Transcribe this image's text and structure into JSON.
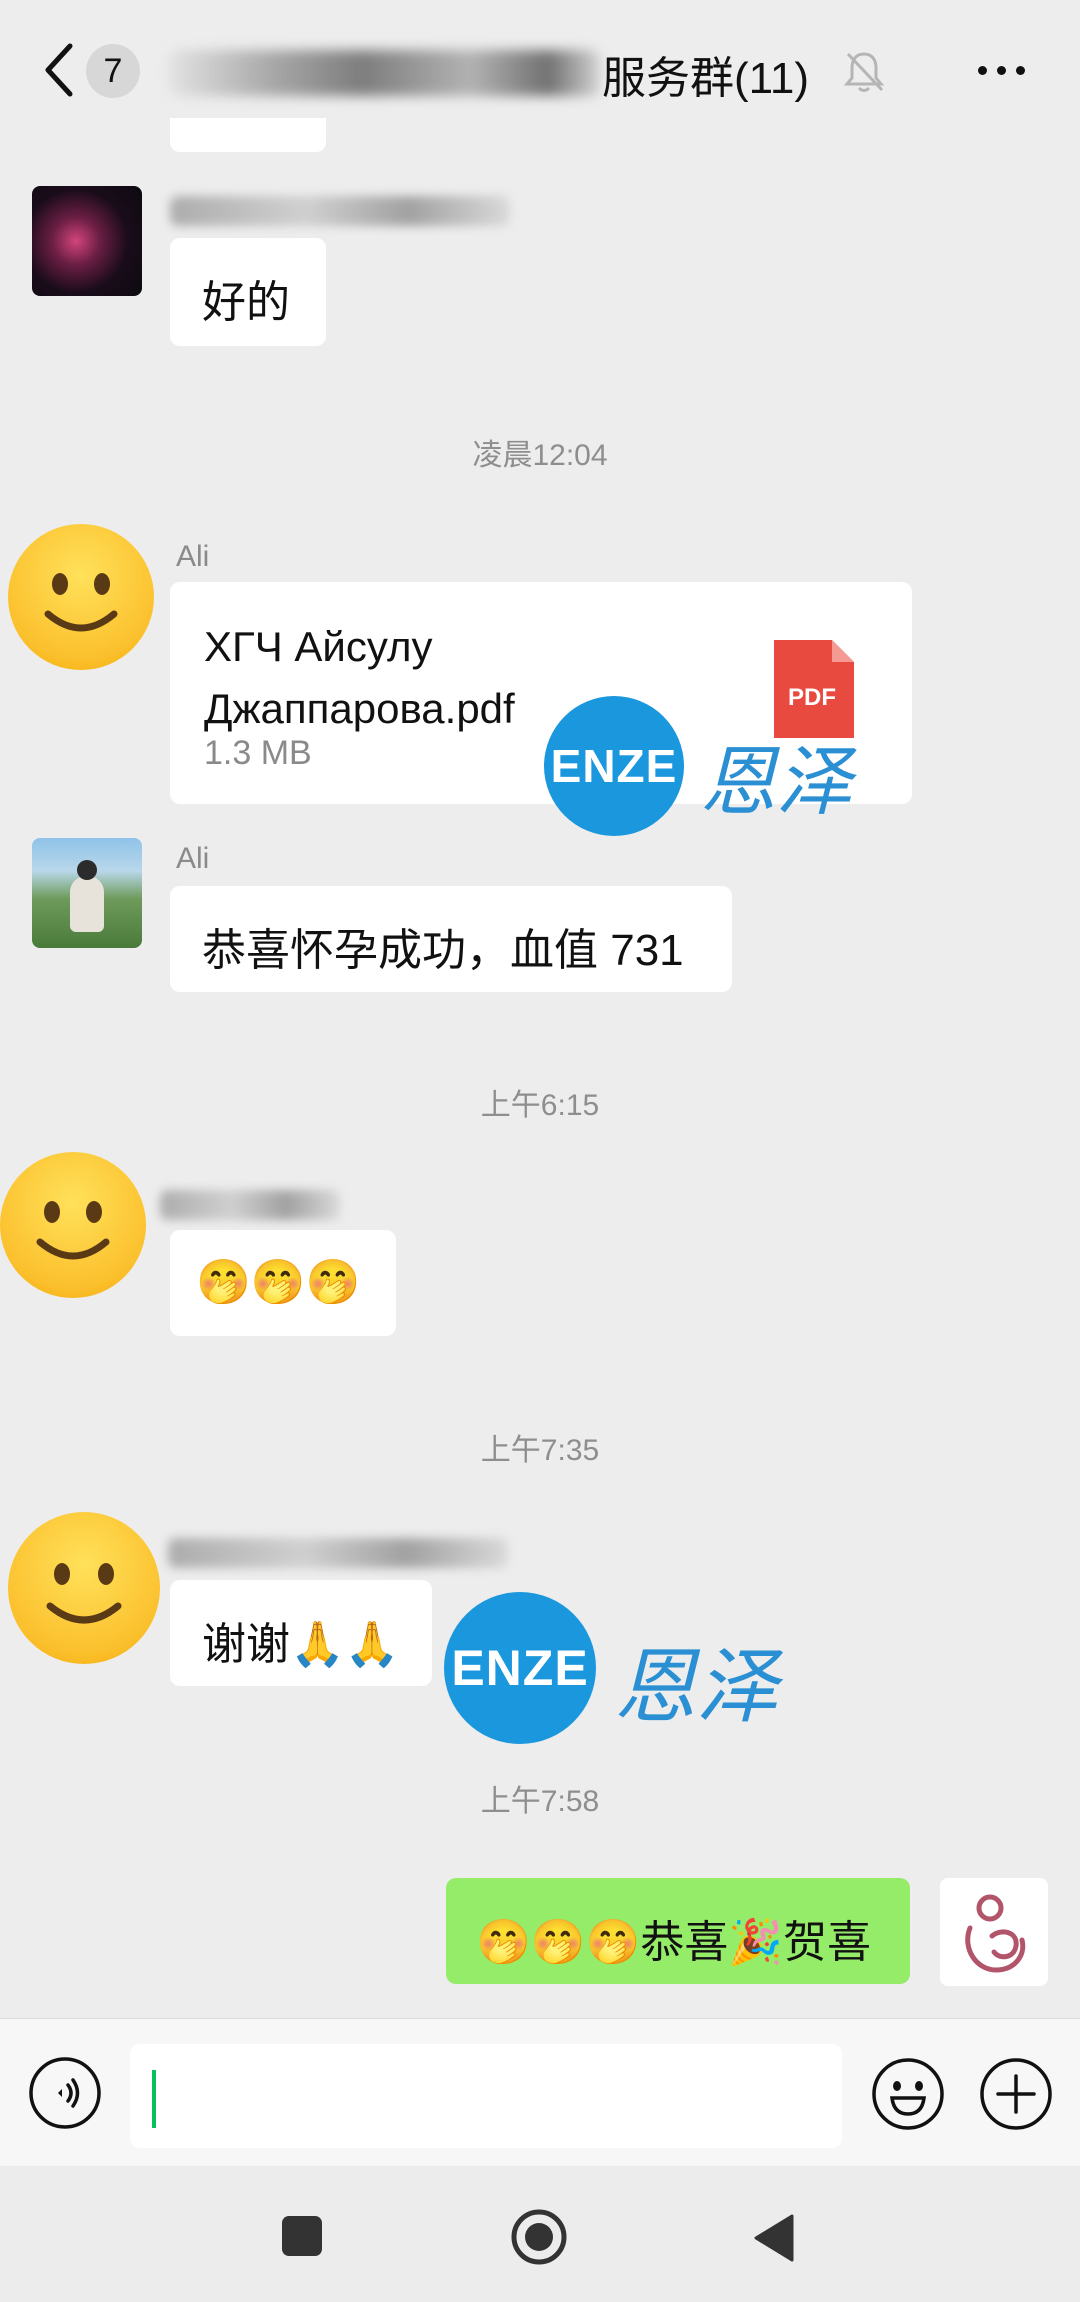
{
  "header": {
    "back_count": "7",
    "title_suffix": "服务群(11)",
    "icons": [
      "chevron-left-icon",
      "bell-muted-icon",
      "more-icon"
    ]
  },
  "messages": {
    "prev_text": "好的",
    "time1": "凌晨12:04",
    "file_sender": "Ali",
    "file_name_line1": "ХГЧ Айсулу",
    "file_name_line2": "Джаппарова.pdf",
    "file_size": "1.3 MB",
    "file_type": "PDF",
    "msg2_sender": "Ali",
    "msg2_text": "恭喜怀孕成功，血值 731",
    "time2": "上午6:15",
    "msg3_text": "🤭🤭🤭",
    "time3": "上午7:35",
    "msg4_text": "谢谢🙏🙏",
    "time4": "上午7:58",
    "my_text": "🤭🤭🤭恭喜🎉贺喜"
  },
  "watermark": {
    "logo_text": "ENZE",
    "cn_text": "恩泽"
  },
  "colors": {
    "my_bubble": "#95ec69",
    "background": "#ededed",
    "cursor": "#07c160",
    "watermark_blue": "#1b97de"
  }
}
